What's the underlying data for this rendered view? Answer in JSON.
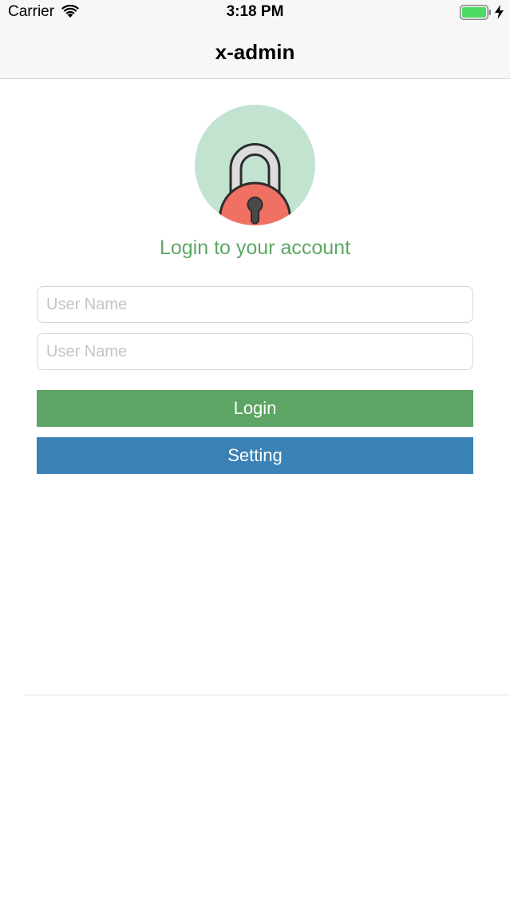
{
  "status_bar": {
    "carrier": "Carrier",
    "time": "3:18 PM",
    "icons": [
      "wifi-icon",
      "battery-icon",
      "charging-icon"
    ],
    "battery_color": "#4cd964"
  },
  "nav": {
    "title": "x-admin"
  },
  "login": {
    "logo_icon": "padlock-icon",
    "heading": "Login to your account",
    "username_placeholder": "User Name",
    "password_placeholder": "User Name",
    "login_label": "Login",
    "setting_label": "Setting"
  },
  "colors": {
    "accent_green": "#5da564",
    "accent_blue": "#3a82b5",
    "logo_background": "#c1e3d0",
    "lock_body": "#f07063"
  }
}
